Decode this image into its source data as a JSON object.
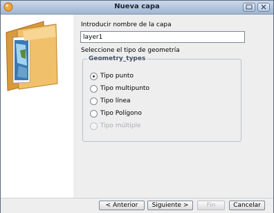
{
  "window": {
    "title": "Nueva capa"
  },
  "form": {
    "name_label": "Introducir nombre de la capa",
    "name_value": "layer1",
    "geometry_label": "Seleccione el tipo de geometría",
    "group_title": "Geometry_types",
    "options": [
      {
        "label": "Tipo punto",
        "selected": true,
        "enabled": true
      },
      {
        "label": "Tipo multipunto",
        "selected": false,
        "enabled": true
      },
      {
        "label": "Tipo línea",
        "selected": false,
        "enabled": true
      },
      {
        "label": "Tipo Polígono",
        "selected": false,
        "enabled": true
      },
      {
        "label": "Tipo múltiple",
        "selected": false,
        "enabled": false
      }
    ]
  },
  "buttons": {
    "back": "< Anterior",
    "next": "Siguiente >",
    "finish": "Fin",
    "cancel": "Cancelar"
  },
  "colors": {
    "titlebar": "#a9bdd8",
    "disabled_text": "#a9adb3"
  }
}
